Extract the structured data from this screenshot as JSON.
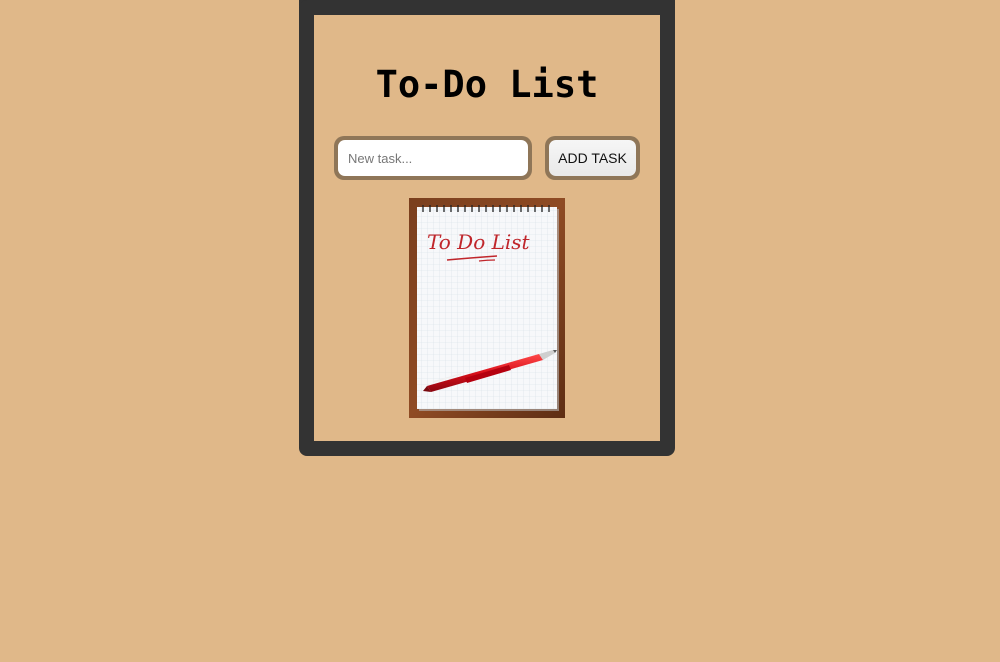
{
  "app": {
    "title": "To-Do List",
    "input": {
      "placeholder": "New task...",
      "value": ""
    },
    "add_button_label": "ADD TASK",
    "illustration": {
      "handwritten_text": "To Do List"
    }
  }
}
